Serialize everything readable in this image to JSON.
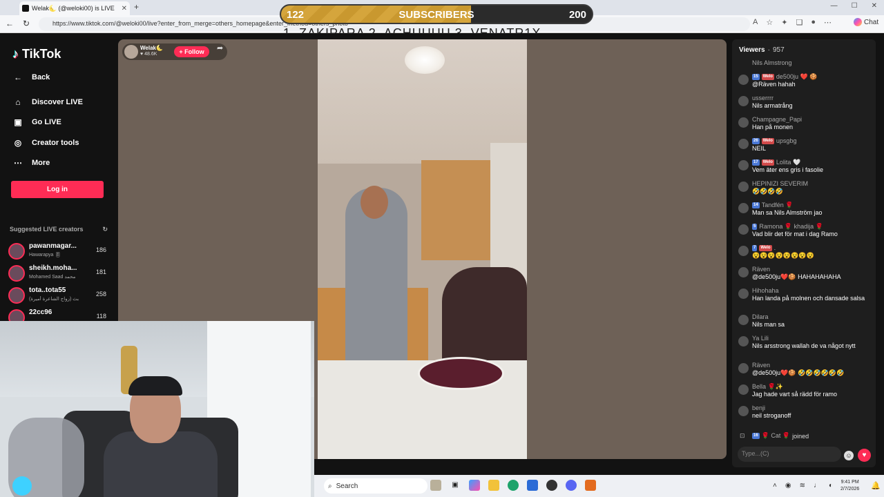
{
  "browser": {
    "tab_title": "Welak🌜 (@weloki00) is LIVE",
    "url": "https://www.tiktok.com/@weloki00/live?enter_from_merge=others_homepage&enter_method=others_photo",
    "chat_button": "Chat"
  },
  "overlay": {
    "current": "122",
    "label": "SUBSCRIBERS",
    "goal": "200",
    "progress": 0.61,
    "rank_text": "1. ZAKIPARA 2. ACHUUUU 3. VENATR1X"
  },
  "sidebar": {
    "brand": "TikTok",
    "back": "Back",
    "menu": [
      "Discover LIVE",
      "Go LIVE",
      "Creator tools",
      "More"
    ],
    "login": "Log in",
    "suggested_title": "Suggested LIVE creators",
    "creators": [
      {
        "name": "pawanmagar...",
        "sub": "Hawarapya 🎚",
        "count": "186"
      },
      {
        "name": "sheikh.moha...",
        "sub": "Mohamed Saad محمد",
        "count": "181"
      },
      {
        "name": "tota..tota55",
        "sub": "(زواج الشاعرة أميرة) بث",
        "count": "258"
      },
      {
        "name": "22cc96",
        "sub": "",
        "count": "118"
      }
    ]
  },
  "stream": {
    "host_name": "Welak🌜",
    "host_likes": "48.6K",
    "follow": "+ Follow"
  },
  "chat": {
    "viewers_label": "Viewers",
    "viewers_count": "957",
    "top_line": "Nils Almstrong",
    "messages": [
      {
        "badges": [
          "15",
          "Welo"
        ],
        "user": "de500ju ❤️ 🍪",
        "text": "@Räven hahah"
      },
      {
        "badges": [],
        "user": "usserrrr",
        "text": "Nils armatrång"
      },
      {
        "badges": [],
        "user": "Champagne_Papi",
        "text": "Han på monen"
      },
      {
        "badges": [
          "26",
          "Welo"
        ],
        "user": "upsgbg",
        "text": "NEIL"
      },
      {
        "badges": [
          "17",
          "Welo"
        ],
        "user": "Lolita 🤍",
        "text": "Vem äter ens gris i fasolie"
      },
      {
        "badges": [],
        "user": "HEPINIZI SEVERIM",
        "text": "🤣🤣🤣🤣"
      },
      {
        "badges": [
          "14"
        ],
        "user": "Tandfén 🌹",
        "text": "Man sa Nils Almström jao"
      },
      {
        "badges": [
          "5"
        ],
        "user": "Ramona 🌹 khadija 🌹",
        "text": "Vad blir det för mat i dag Ramo"
      },
      {
        "badges": [
          "7",
          "Welo"
        ],
        "user": ".",
        "text": "😵😵😵😵😵😵😵😵"
      },
      {
        "badges": [],
        "user": "Räven",
        "text": "@de500ju❤️🍪 HAHAHAHAHA"
      },
      {
        "badges": [],
        "user": "Hihohaha",
        "text": "Han landa på molnen och dansade salsa"
      },
      {
        "badges": [],
        "user": "Dilara",
        "text": "Nils man sa"
      },
      {
        "badges": [],
        "user": "Ya Lili",
        "text": "Nils arsstrong wallah de va något nytt"
      },
      {
        "badges": [],
        "user": "Räven",
        "text": "@de500ju❤️🍪 🤣🤣🤣🤣🤣🤣"
      },
      {
        "badges": [],
        "user": "Bella 🌹✨",
        "text": "Jag hade vart så rädd för ramo"
      },
      {
        "badges": [],
        "user": "benji",
        "text": "neil stroganoff"
      }
    ],
    "joined_badge": "16",
    "joined_user": "🌹 Cat 🌹",
    "joined_text": "joined",
    "input_placeholder": "Type...(C)"
  },
  "taskbar": {
    "search": "Search",
    "time": "9:41 PM",
    "date": "2/7/2026"
  }
}
